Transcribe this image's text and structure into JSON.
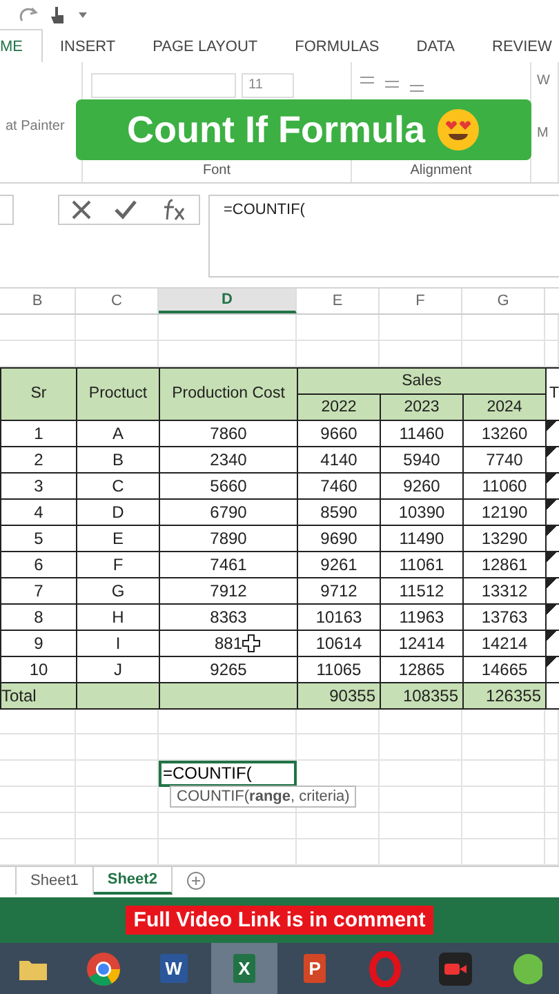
{
  "ribbon_tabs": [
    {
      "label": "ME",
      "selected": true
    },
    {
      "label": "INSERT",
      "selected": false
    },
    {
      "label": "PAGE LAYOUT",
      "selected": false
    },
    {
      "label": "FORMULAS",
      "selected": false
    },
    {
      "label": "DATA",
      "selected": false
    },
    {
      "label": "REVIEW",
      "selected": false
    }
  ],
  "ribbon": {
    "format_painter": "at Painter",
    "font_size": "11",
    "font_group": "Font",
    "alignment_group": "Alignment",
    "wrap": "W",
    "merge": "M"
  },
  "title_banner": "Count If Formula",
  "formula_bar": {
    "formula": "=COUNTIF("
  },
  "columns": [
    {
      "label": "B",
      "selected": false
    },
    {
      "label": "C",
      "selected": false
    },
    {
      "label": "D",
      "selected": true
    },
    {
      "label": "E",
      "selected": false
    },
    {
      "label": "F",
      "selected": false
    },
    {
      "label": "G",
      "selected": false
    }
  ],
  "table": {
    "headers": [
      "Sr",
      "Proctuct",
      "Production Cost"
    ],
    "group_header": "Sales",
    "years": [
      "2022",
      "2023",
      "2024"
    ],
    "cut_header": "T",
    "rows": [
      [
        "1",
        "A",
        "7860",
        "9660",
        "11460",
        "13260"
      ],
      [
        "2",
        "B",
        "2340",
        "4140",
        "5940",
        "7740"
      ],
      [
        "3",
        "C",
        "5660",
        "7460",
        "9260",
        "11060"
      ],
      [
        "4",
        "D",
        "6790",
        "8590",
        "10390",
        "12190"
      ],
      [
        "5",
        "E",
        "7890",
        "9690",
        "11490",
        "13290"
      ],
      [
        "6",
        "F",
        "7461",
        "9261",
        "11061",
        "12861"
      ],
      [
        "7",
        "G",
        "7912",
        "9712",
        "11512",
        "13312"
      ],
      [
        "8",
        "H",
        "8363",
        "10163",
        "11963",
        "13763"
      ],
      [
        "9",
        "I",
        "881",
        "10614",
        "12414",
        "14214"
      ],
      [
        "10",
        "J",
        "9265",
        "11065",
        "12865",
        "14665"
      ]
    ],
    "total": {
      "label": "Total",
      "values": [
        "90355",
        "108355",
        "126355"
      ]
    }
  },
  "active_cell": {
    "value": "=COUNTIF(",
    "tooltip": "COUNTIF(**range**, criteria)"
  },
  "sheet_tabs": [
    {
      "label": "Sheet1",
      "selected": false
    },
    {
      "label": "Sheet2",
      "selected": true
    }
  ],
  "caption": "Full Video Link is in comment",
  "taskbar": [
    {
      "kind": "folder",
      "selected": false
    },
    {
      "kind": "chrome",
      "selected": false
    },
    {
      "kind": "word",
      "label": "W",
      "selected": false
    },
    {
      "kind": "excel",
      "label": "X",
      "selected": true
    },
    {
      "kind": "powerpoint",
      "label": "P",
      "selected": false
    },
    {
      "kind": "opera",
      "selected": false
    },
    {
      "kind": "recorder",
      "selected": false
    },
    {
      "kind": "torrent",
      "selected": false
    }
  ]
}
